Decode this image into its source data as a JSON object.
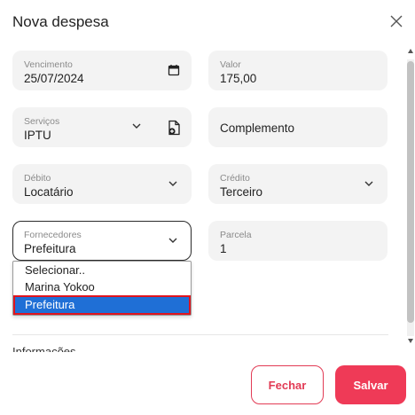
{
  "modal": {
    "title": "Nova despesa"
  },
  "fields": {
    "vencimento": {
      "label": "Vencimento",
      "value": "25/07/2024"
    },
    "valor": {
      "label": "Valor",
      "value": "175,00"
    },
    "servicos": {
      "label": "Serviços",
      "value": "IPTU"
    },
    "complemento": {
      "placeholder": "Complemento"
    },
    "debito": {
      "label": "Débito",
      "value": "Locatário"
    },
    "credito": {
      "label": "Crédito",
      "value": "Terceiro"
    },
    "fornecedores": {
      "label": "Fornecedores",
      "value": "Prefeitura",
      "options": [
        "Selecionar..",
        "Marina Yokoo",
        "Prefeitura"
      ],
      "selected_index": 2
    },
    "parcela": {
      "label": "Parcela",
      "value": "1"
    }
  },
  "partial_section_label": "Informações",
  "buttons": {
    "close_label": "Fechar",
    "save_label": "Salvar"
  },
  "colors": {
    "accent": "#ef3a57",
    "selection": "#1f6fd6",
    "highlight_border": "#e0141e"
  }
}
